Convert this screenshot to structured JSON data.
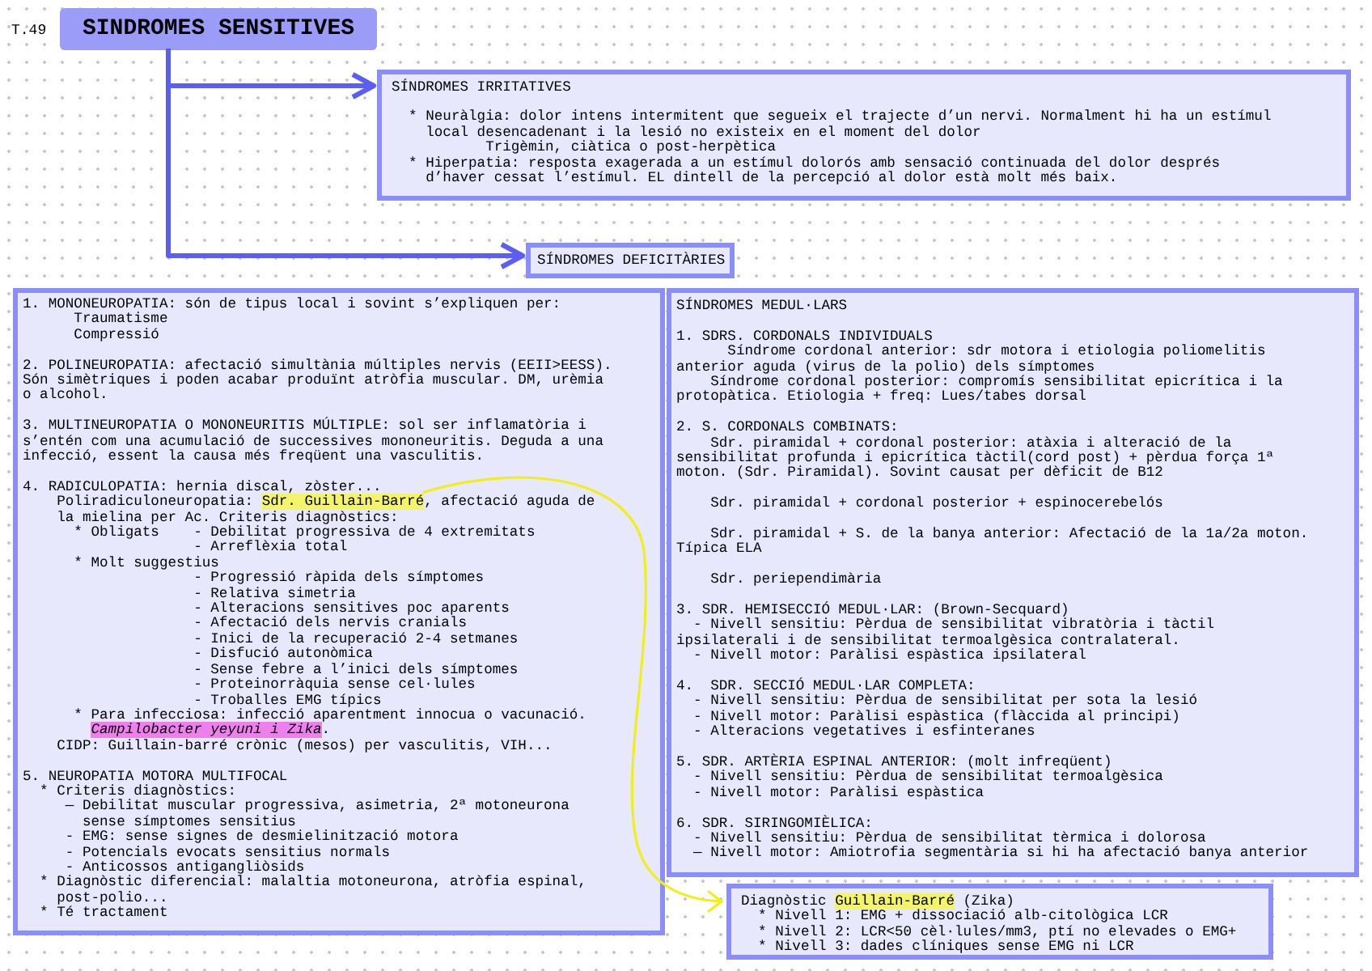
{
  "page_label": "T.49",
  "title": "SINDROMES SENSITIVES",
  "notes": [
    {
      "paragraphs": [
        [
          "SÍNDROMES IRRITATIVES"
        ],
        [
          "  * Neuràlgia: dolor intens intermitent que segueix el trajecte d’un nervi. Normalment hi ha un estímul",
          "    local desencadenant i la lesió no existeix en el moment del dolor",
          "           Trigèmin, ciàtica o post-herpètica",
          "  * Hiperpatia: resposta exagerada a un estímul dolorós amb sensació continuada del dolor després",
          "    d’haver cessat l’estímul. EL dintell de la percepció al dolor està molt més baix."
        ]
      ]
    },
    {
      "paragraphs": [
        [
          "SÍNDROMES DEFICITÀRIES"
        ]
      ]
    },
    {
      "paragraphs": [
        [
          "1. MONONEUROPATIA: són de tipus local i sovint s’expliquen per:",
          "      Traumatisme",
          "      Compressió"
        ],
        [
          "2. POLINEUROPATIA: afectació simultània múltiples nervis (EEII>EESS).",
          "Són simètriques i poden acabar produïnt atròfia muscular. DM, urèmia",
          "o alcohol."
        ],
        [
          "3. MULTINEUROPATIA O MONONEURITIS MÚLTIPLE: sol ser inflamatòria i",
          "s’entén com una acumulació de successives mononeuritis. Deguda a una",
          "infecció, essent la causa més freqüent una vasculitis."
        ],
        [
          "4. RADICULOPATIA: hernia discal, zòster...",
          {
            "segments": [
              {
                "text": "    Poliradiculoneuropatia: "
              },
              {
                "text": "Sdr. Guillain-Barré",
                "color": "#f4f46a"
              },
              {
                "text": ", afectació aguda de"
              }
            ]
          },
          "    la mielina per Ac. Criteris diagnòstics:",
          "      * Obligats    - Debilitat progressiva de 4 extremitats",
          "                    - Arreflèxia total",
          "      * Molt suggestius",
          "                    - Progressió ràpida dels símptomes",
          "                    - Relativa simetria",
          "                    - Alteracions sensitives poc aparents",
          "                    - Afectació dels nervis cranials",
          "                    - Inici de la recuperació 2-4 setmanes",
          "                    - Disfució autonòmica",
          "                    - Sense febre a l’inici dels símptomes",
          "                    - Proteinorràquia sense cel·lules",
          "                    - Troballes EMG típics",
          "      * Para infecciosa: infecció aparentment innocua o vacunació.",
          {
            "kind": "indented",
            "segments": [
              {
                "text": "Campilobacter yeyuni i Zika",
                "color": "#ee80ee",
                "italic": true
              },
              {
                "text": "."
              }
            ]
          },
          "    CIDP: Guillain-barré crònic (mesos) per vasculitis, VIH..."
        ],
        [
          "5. NEUROPATIA MOTORA MULTIFOCAL",
          "  * Criteris diagnòstics:",
          "     — Debilitat muscular progressiva, asimetria, 2ª motoneurona",
          "       sense símptomes sensitius",
          "     - EMG: sense signes de desmielinització motora",
          "     - Potencials evocats sensitius normals",
          "     - Anticossos antigangliòsids",
          "  * Diagnòstic diferencial: malaltia motoneurona, atròfia espinal,",
          "    post-polio...",
          "  * Té tractament"
        ]
      ]
    },
    {
      "paragraphs": [
        [
          "SÍNDROMES MEDUL·LARS"
        ],
        [
          "1. SDRS. CORDONALS INDIVIDUALS",
          "      Síndrome cordonal anterior: sdr motora i etiologia poliomelitis",
          "anterior aguda (virus de la polio) dels símptomes",
          "    Síndrome cordonal posterior: compromís sensibilitat epicrítica i la",
          "protopàtica. Etiologia + freq: Lues/tabes dorsal"
        ],
        [
          "2. S. CORDONALS COMBINATS:",
          "    Sdr. piramidal + cordonal posterior: atàxia i alteració de la",
          "sensibilitat profunda i epicrítica tàctil(cord post) + pèrdua força 1ª",
          "moton. (Sdr. Piramidal). Sovint causat per dèficit de B12"
        ],
        [
          "    Sdr. piramidal + cordonal posterior + espinocerebelós"
        ],
        [
          "    Sdr. piramidal + S. de la banya anterior: Afectació de la 1a/2a moton.",
          "Típica ELA"
        ],
        [
          "    Sdr. periependimària"
        ],
        [
          "3. SDR. HEMISECCIÓ MEDUL·LAR: (Brown-Secquard)",
          "  - Nivell sensitiu: Pèrdua de sensibilitat vibratòria i tàctil",
          "ipsilaterali i de sensibilitat termoalgèsica contralateral.",
          "  - Nivell motor: Paràlisi espàstica ipsilateral"
        ],
        [
          "4.  SDR. SECCIÓ MEDUL·LAR COMPLETA:",
          "  - Nivell sensitiu: Pèrdua de sensibilitat per sota la lesió",
          "  - Nivell motor: Paràlisi espàstica (flàccida al principi)",
          "  - Alteracions vegetatives i esfinteranes"
        ],
        [
          "5. SDR. ARTÈRIA ESPINAL ANTERIOR: (molt infreqüent)",
          "  - Nivell sensitiu: Pèrdua de sensibilitat termoalgèsica",
          "  - Nivell motor: Paràlisi espàstica"
        ],
        [
          "6. SDR. SIRINGOMIÈLICA:",
          "  - Nivell sensitiu: Pèrdua de sensibilitat tèrmica i dolorosa",
          "  — Nivell motor: Amiotrofia segmentària si hi ha afectació banya anterior"
        ]
      ]
    },
    {
      "paragraphs": [
        [
          {
            "segments": [
              {
                "text": "Diagnòstic "
              },
              {
                "text": "Guillain-Barré",
                "color": "#f4f46a"
              },
              {
                "text": " (Zika)"
              }
            ]
          },
          "  * Nivell 1: EMG + dissociació alb-citològica LCR",
          "  * Nivell 2: LCR<50 cèl·lules/mm3, ptí no elevades o EMG+",
          "  * Nivell 3: dades clíniques sense EMG ni LCR"
        ]
      ]
    }
  ]
}
